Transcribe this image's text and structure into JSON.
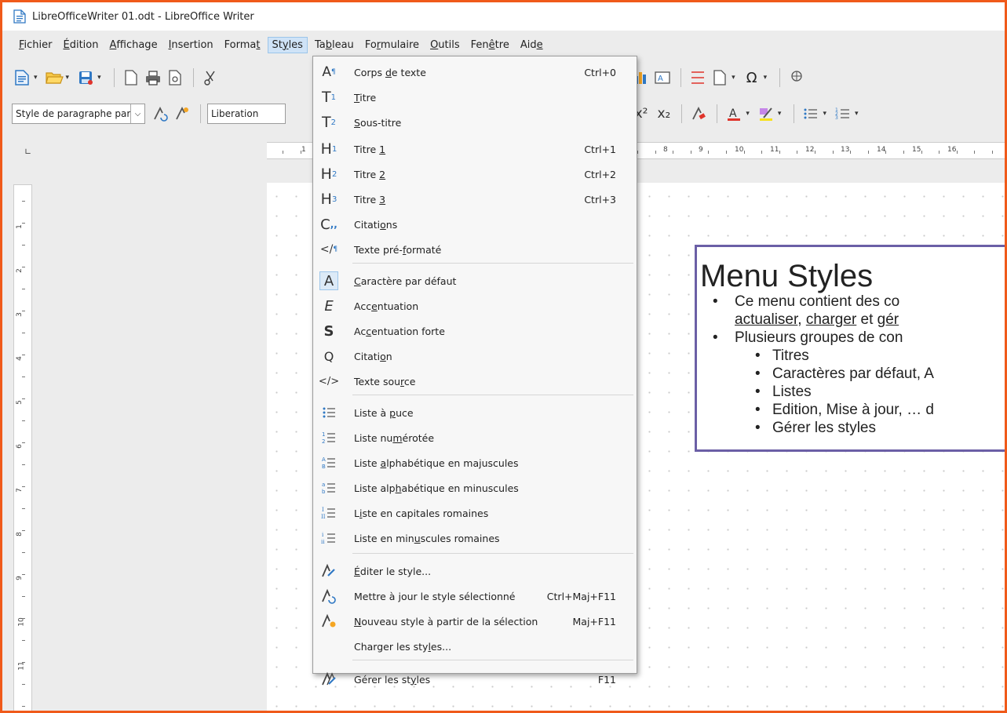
{
  "window": {
    "title": "LibreOfficeWriter 01.odt - LibreOffice Writer"
  },
  "menubar": [
    {
      "pre": "",
      "u": "F",
      "post": "ichier"
    },
    {
      "pre": "",
      "u": "É",
      "post": "dition"
    },
    {
      "pre": "",
      "u": "A",
      "post": "ffichage"
    },
    {
      "pre": "",
      "u": "I",
      "post": "nsertion"
    },
    {
      "pre": "Forma",
      "u": "t",
      "post": ""
    },
    {
      "pre": "St",
      "u": "y",
      "post": "les"
    },
    {
      "pre": "Ta",
      "u": "b",
      "post": "leau"
    },
    {
      "pre": "Fo",
      "u": "r",
      "post": "mulaire"
    },
    {
      "pre": "",
      "u": "O",
      "post": "utils"
    },
    {
      "pre": "Fen",
      "u": "ê",
      "post": "tre"
    },
    {
      "pre": "Aid",
      "u": "e",
      "post": ""
    }
  ],
  "toolbar2": {
    "paragraph_style": "Style de paragraphe par",
    "font_name": "Liberation"
  },
  "styles_menu": {
    "items": [
      {
        "pre": "Corps ",
        "u": "d",
        "post": "e texte",
        "shortcut": "Ctrl+0",
        "icon": "A¶"
      },
      {
        "pre": "",
        "u": "T",
        "post": "itre",
        "shortcut": "",
        "icon": "T1"
      },
      {
        "pre": "",
        "u": "S",
        "post": "ous-titre",
        "shortcut": "",
        "icon": "T2"
      },
      {
        "pre": "Titre ",
        "u": "1",
        "post": "",
        "shortcut": "Ctrl+1",
        "icon": "H1"
      },
      {
        "pre": "Titre ",
        "u": "2",
        "post": "",
        "shortcut": "Ctrl+2",
        "icon": "H2"
      },
      {
        "pre": "Titre ",
        "u": "3",
        "post": "",
        "shortcut": "Ctrl+3",
        "icon": "H3"
      },
      {
        "pre": "Citati",
        "u": "o",
        "post": "ns",
        "shortcut": "",
        "icon": "quote"
      },
      {
        "pre": "Texte pré-",
        "u": "f",
        "post": "ormaté",
        "shortcut": "",
        "icon": "code¶"
      },
      {
        "pre": "",
        "u": "C",
        "post": "aractère par défaut",
        "shortcut": "",
        "icon": "A"
      },
      {
        "pre": "Acc",
        "u": "e",
        "post": "ntuation",
        "shortcut": "",
        "icon": "E"
      },
      {
        "pre": "Ac",
        "u": "c",
        "post": "entuation forte",
        "shortcut": "",
        "icon": "S"
      },
      {
        "pre": "Citati",
        "u": "o",
        "post": "n",
        "shortcut": "",
        "icon": "Q"
      },
      {
        "pre": "Texte sou",
        "u": "r",
        "post": "ce",
        "shortcut": "",
        "icon": "</>"
      },
      {
        "pre": "Liste à ",
        "u": "p",
        "post": "uce",
        "shortcut": "",
        "icon": "bullets"
      },
      {
        "pre": "Liste nu",
        "u": "m",
        "post": "érotée",
        "shortcut": "",
        "icon": "numbers"
      },
      {
        "pre": "Liste ",
        "u": "a",
        "post": "lphabétique en majuscules",
        "shortcut": "",
        "icon": "alpha-upper"
      },
      {
        "pre": "Liste alp",
        "u": "h",
        "post": "abétique en minuscules",
        "shortcut": "",
        "icon": "alpha-lower"
      },
      {
        "pre": "L",
        "u": "i",
        "post": "ste en capitales romaines",
        "shortcut": "",
        "icon": "roman-upper"
      },
      {
        "pre": "Liste en min",
        "u": "u",
        "post": "scules romaines",
        "shortcut": "",
        "icon": "roman-lower"
      },
      {
        "pre": "",
        "u": "É",
        "post": "diter le style...",
        "shortcut": "",
        "icon": "edit-style"
      },
      {
        "pre": "Mettre à ",
        "u": "j",
        "post": "our le style sélectionné",
        "shortcut": "Ctrl+Maj+F11",
        "icon": "update-style"
      },
      {
        "pre": "",
        "u": "N",
        "post": "ouveau style à partir de la sélection",
        "shortcut": "Maj+F11",
        "icon": "new-style"
      },
      {
        "pre": "Charger les sty",
        "u": "l",
        "post": "es...",
        "shortcut": "",
        "icon": ""
      },
      {
        "pre": "Gérer les st",
        "u": "y",
        "post": "les",
        "shortcut": "F11",
        "icon": "manage-styles"
      }
    ]
  },
  "ruler": {
    "h_numbers": [
      "1",
      "8",
      "9",
      "10",
      "11",
      "12",
      "13",
      "14",
      "15",
      "16"
    ],
    "v_numbers": [
      "1",
      "2",
      "3",
      "4",
      "5",
      "6",
      "7",
      "8",
      "9",
      "10",
      "11"
    ]
  },
  "callout": {
    "title": "Menu Styles",
    "line1": "Ce menu contient des co",
    "line2_a": "actualiser",
    "line2_b": ", ",
    "line2_c": "charger",
    "line2_d": " et ",
    "line2_e": "gér",
    "line3": "Plusieurs groupes de con",
    "sub": [
      "Titres",
      "Caractères par défaut, A",
      "Listes",
      "Edition, Mise à jour, … d",
      "Gérer les styles"
    ]
  },
  "colors": {
    "frame": "#f05a1a",
    "callout_border": "#6b5fa6",
    "menu_highlight": "#cfe3f7",
    "icon_blue": "#2f78c4"
  }
}
